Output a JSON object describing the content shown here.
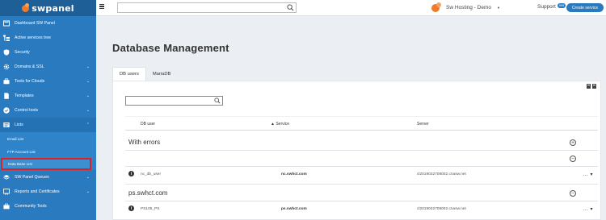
{
  "brand": {
    "name": "swpanel"
  },
  "sidebar": {
    "items": [
      {
        "label": "Dashboard SW Panel",
        "icon": "dashboard-icon",
        "has_children": false
      },
      {
        "label": "Active services tree",
        "icon": "tree-icon",
        "has_children": false
      },
      {
        "label": "Security",
        "icon": "shield-icon",
        "has_children": false
      },
      {
        "label": "Domains & SSL",
        "icon": "gear-icon",
        "has_children": true
      },
      {
        "label": "Tools for Clouds",
        "icon": "briefcase-icon",
        "has_children": true
      },
      {
        "label": "Templates",
        "icon": "document-icon",
        "has_children": true
      },
      {
        "label": "Control tools",
        "icon": "check-circle-icon",
        "has_children": true
      },
      {
        "label": "Lists",
        "icon": "list-icon",
        "has_children": true,
        "open": true
      },
      {
        "label": "SW Panel Queues",
        "icon": "layers-icon",
        "has_children": true
      },
      {
        "label": "Reports and Certificates",
        "icon": "report-icon",
        "has_children": true
      },
      {
        "label": "Community Tools",
        "icon": "toolbox-icon",
        "has_children": false
      }
    ],
    "lists_children": [
      {
        "label": "Email List",
        "active": false
      },
      {
        "label": "FTP Account List",
        "active": false
      },
      {
        "label": "Data Base List",
        "active": true
      }
    ],
    "chevron": "⌄",
    "chevron_up": "⌃"
  },
  "topbar": {
    "search_value": "",
    "org_name": "Sw Hosting - Demo",
    "org_caret": "▼",
    "support_label": "Support",
    "support_badge": "999",
    "support_caret": "▼",
    "create_label": "Create service"
  },
  "page": {
    "title": "Database Management",
    "tabs": [
      {
        "label": "DB users",
        "active": true
      },
      {
        "label": "MariaDB",
        "active": false
      }
    ]
  },
  "table": {
    "filter_value": "",
    "headers": {
      "user": "DB user",
      "service": "Service",
      "service_sort": "▲",
      "server": "Server"
    },
    "groups": [
      {
        "title": "With errors",
        "rows": [
          {
            "user": "nc_db_user",
            "service": "nc.swhct.com",
            "server": "cl2019032708002.cnasw.net"
          }
        ]
      },
      {
        "title": "ps.swhct.com",
        "rows": [
          {
            "user": "PS105_PS",
            "service": "ps.swhct.com",
            "server": "cl2019032708002.cnasw.net"
          }
        ]
      }
    ],
    "info_glyph": "i",
    "actions": "... ▾",
    "expand_glyph": "+",
    "collapse_glyph": "−"
  }
}
